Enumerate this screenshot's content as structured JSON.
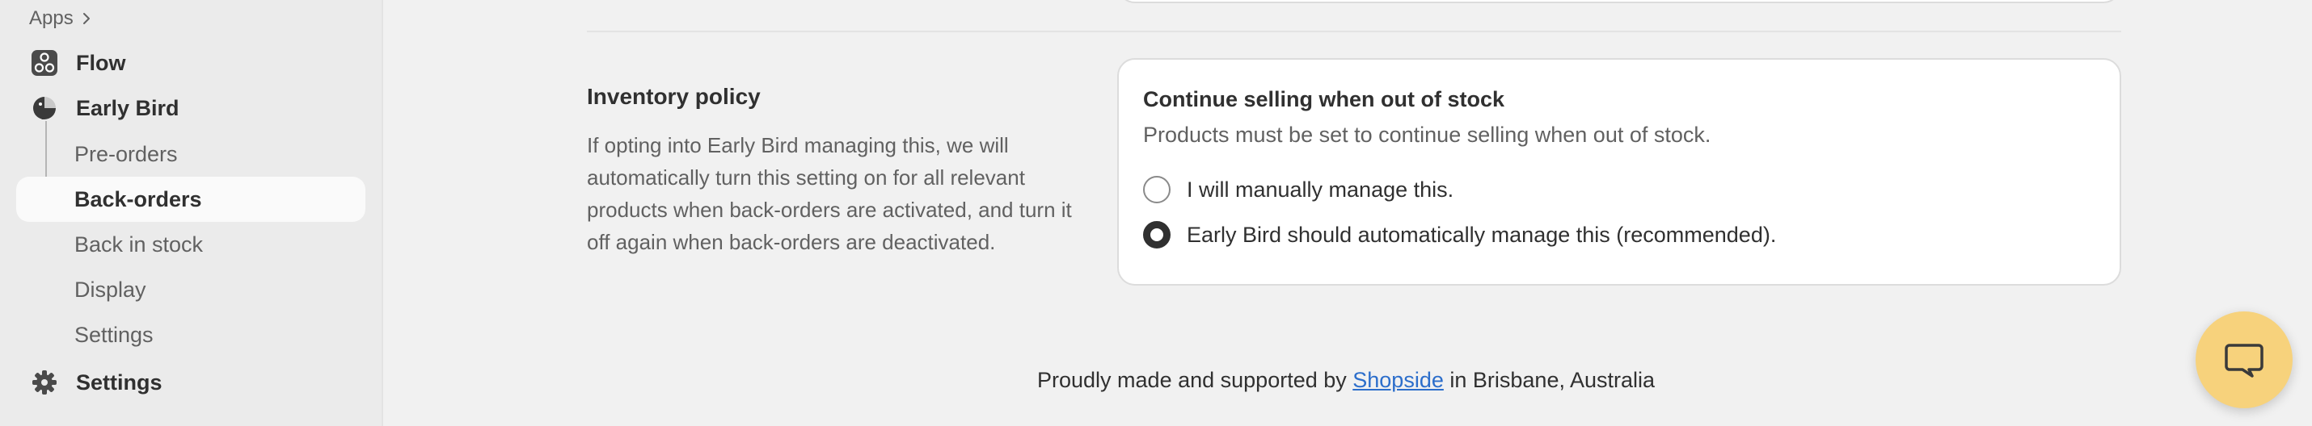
{
  "sidebar": {
    "apps_label": "Apps",
    "items": [
      {
        "label": "Flow",
        "icon": "flow-icon"
      },
      {
        "label": "Early Bird",
        "icon": "early-bird-icon"
      },
      {
        "label": "Pre-orders"
      },
      {
        "label": "Back-orders",
        "active": true
      },
      {
        "label": "Back in stock"
      },
      {
        "label": "Display"
      },
      {
        "label": "Settings"
      },
      {
        "label": "Settings",
        "icon": "gear-icon"
      }
    ]
  },
  "main": {
    "section_title": "Inventory policy",
    "section_description": "If opting into Early Bird managing this, we will automatically turn this setting on for all relevant products when back-orders are activated, and turn it off again when back-orders are deactivated.",
    "card": {
      "title": "Continue selling when out of stock",
      "subtitle": "Products must be set to continue selling when out of stock.",
      "options": [
        {
          "label": "I will manually manage this.",
          "selected": false
        },
        {
          "label": "Early Bird should automatically manage this (recommended).",
          "selected": true
        }
      ]
    }
  },
  "footer": {
    "prefix": "Proudly made and supported by",
    "link_text": "Shopside",
    "suffix": "in Brisbane, Australia"
  },
  "chat": {
    "icon": "chat-bubble-icon"
  },
  "colors": {
    "background": "#f1f1f1",
    "sidebar": "#ebebeb",
    "card": "#ffffff",
    "link": "#2c6ecb",
    "chat_button": "#f7d27c"
  }
}
